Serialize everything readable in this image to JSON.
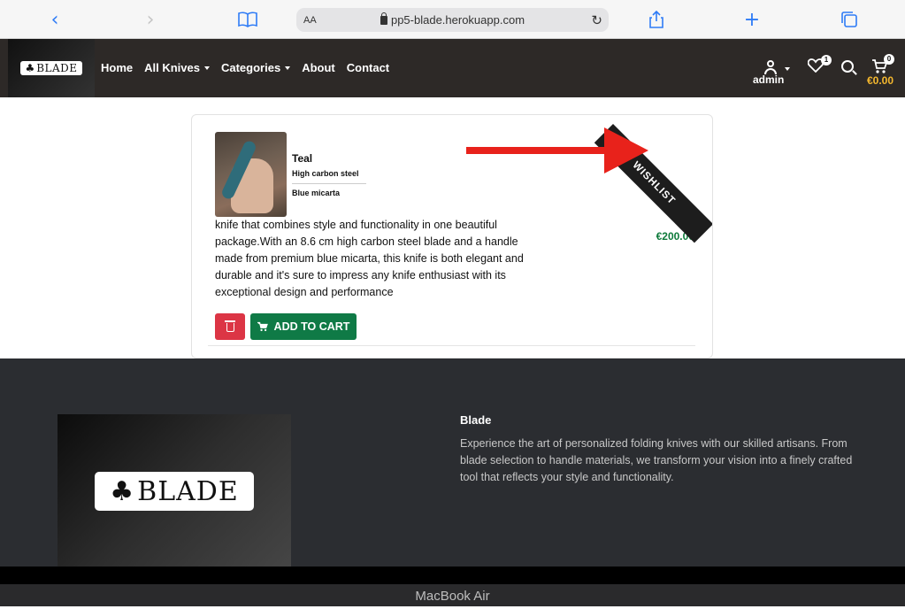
{
  "browser": {
    "text_size_label": "AA",
    "url": "pp5-blade.herokuapp.com",
    "accent": "#2f7cf6"
  },
  "nav": {
    "logo_text": "BLADE",
    "links": [
      "Home",
      "All Knives",
      "Categories",
      "About",
      "Contact"
    ],
    "user_label": "admin",
    "wishlist_count": "1",
    "cart_count": "0",
    "cart_total": "€0.00",
    "background": "#2d2927",
    "total_color": "#f5b82e"
  },
  "wishlist_item": {
    "name": "Teal",
    "blade_material": "High carbon steel",
    "handle_material": "Blue micarta",
    "description": "knife that combines style and functionality in one beautiful package.With an 8.6 cm high carbon steel blade and a handle made from premium blue micarta, this knife is both elegant and durable and it's sure to impress any knife enthusiast with its exceptional design and performance",
    "price": "€200.00",
    "add_to_cart_label": "ADD TO CART",
    "ribbon_label": "WISHLIST",
    "delete_color": "#dc3545",
    "cart_button_color": "#0f7a46"
  },
  "footer": {
    "logo_text": "BLADE",
    "heading": "Blade",
    "text": "Experience the art of personalized folding knives with our skilled artisans. From blade selection to handle materials, we transform your vision into a finely crafted tool that reflects your style and functionality."
  },
  "device": {
    "label": "MacBook Air"
  }
}
